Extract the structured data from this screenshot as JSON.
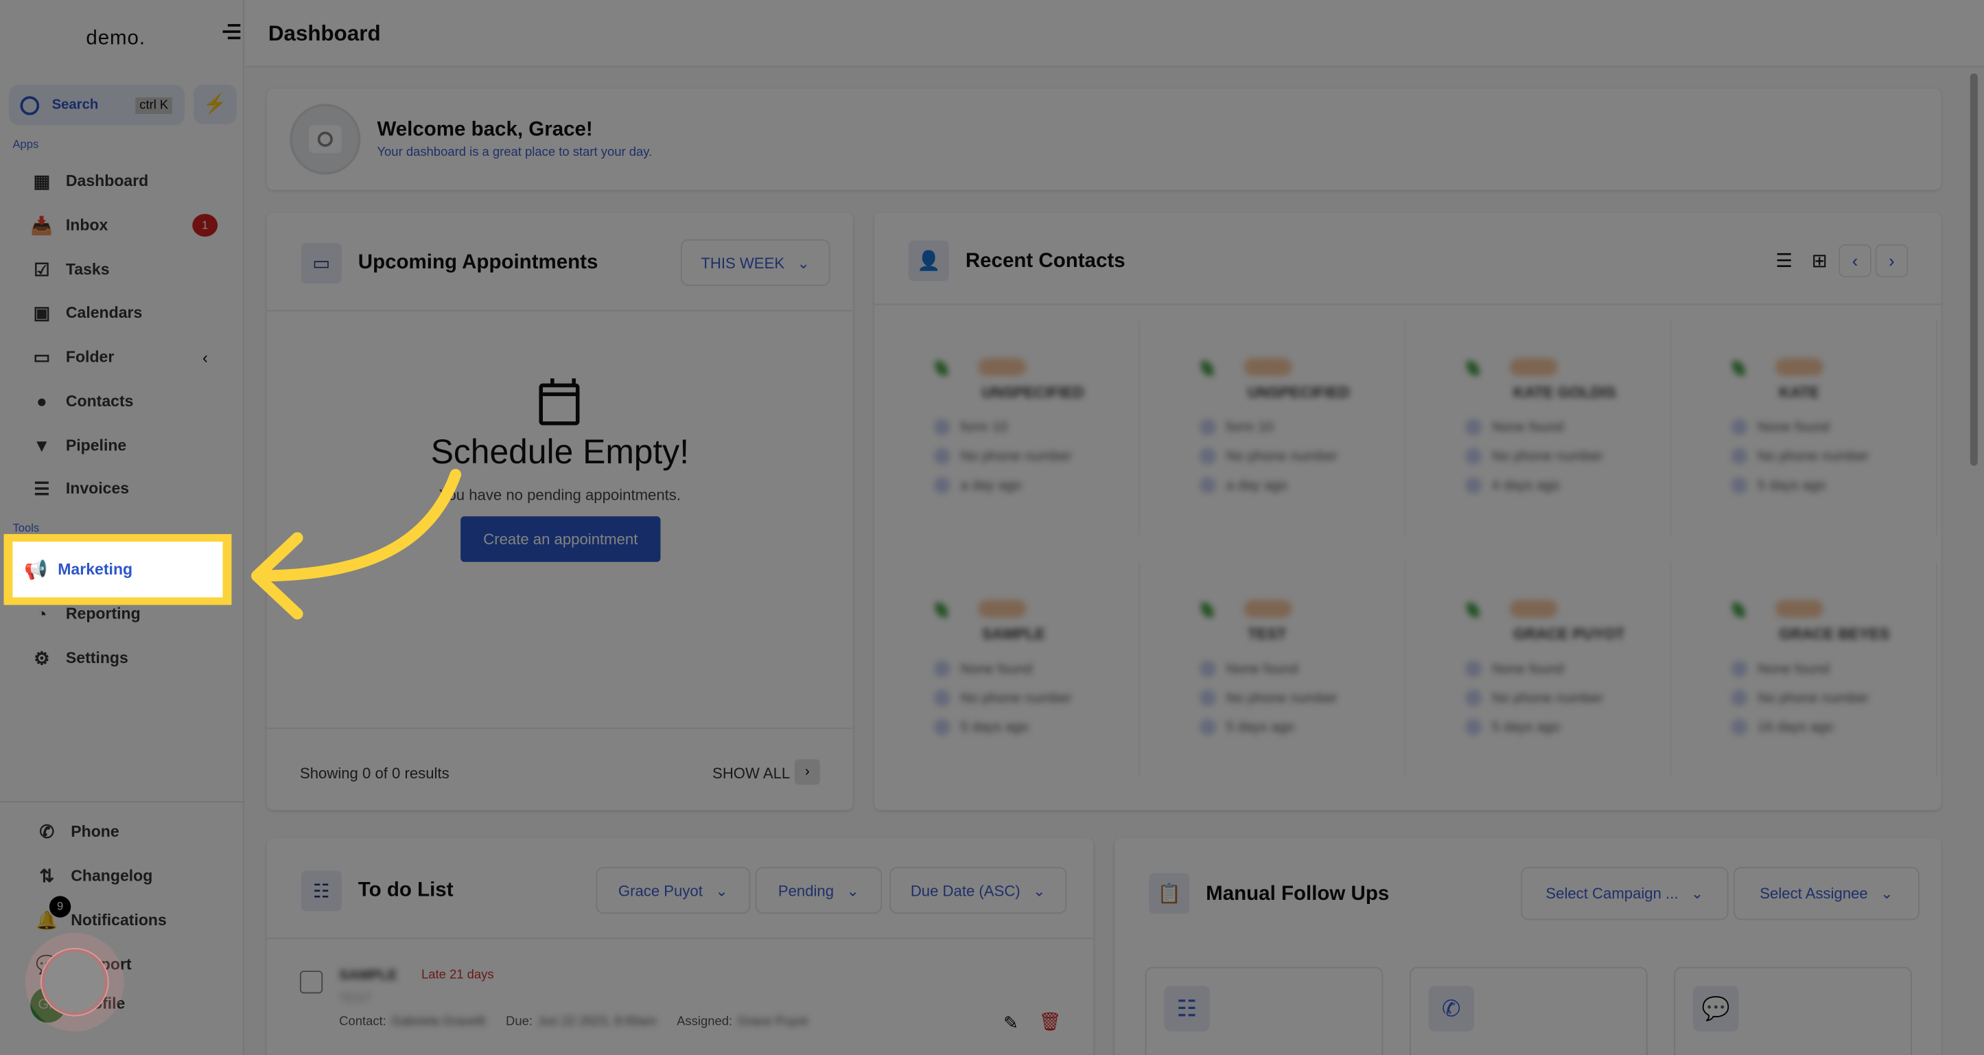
{
  "sidebar": {
    "logo": "demo.",
    "search_label": "Search",
    "search_shortcut": "ctrl K",
    "apps_heading": "Apps",
    "tools_heading": "Tools",
    "apps": [
      {
        "label": "Dashboard",
        "icon": "grid-icon"
      },
      {
        "label": "Inbox",
        "icon": "inbox-icon",
        "badge": "1"
      },
      {
        "label": "Tasks",
        "icon": "clipboard-icon"
      },
      {
        "label": "Calendars",
        "icon": "calendar-icon"
      },
      {
        "label": "Folder",
        "icon": "folder-icon"
      },
      {
        "label": "Contacts",
        "icon": "person-icon"
      },
      {
        "label": "Pipeline",
        "icon": "filter-icon"
      },
      {
        "label": "Invoices",
        "icon": "invoice-icon"
      }
    ],
    "tools": [
      {
        "label": "Marketing",
        "icon": "megaphone-icon"
      },
      {
        "label": "Reporting",
        "icon": "chart-icon"
      },
      {
        "label": "Settings",
        "icon": "gear-icon"
      }
    ],
    "bottom": [
      {
        "label": "Phone"
      },
      {
        "label": "Changelog"
      },
      {
        "label": "Notifications",
        "badge": "9"
      },
      {
        "label": "Support"
      },
      {
        "label": "Profile",
        "avatar": "GP"
      }
    ]
  },
  "header": {
    "title": "Dashboard"
  },
  "welcome": {
    "title": "Welcome back, Grace!",
    "subtitle": "Your dashboard is a great place to start your day."
  },
  "appointments": {
    "title": "Upcoming Appointments",
    "filter": "THIS WEEK",
    "empty_title": "Schedule Empty!",
    "empty_sub": "You have no pending appointments.",
    "create_label": "Create an appointment",
    "results": "Showing 0 of 0 results",
    "show_all": "SHOW ALL"
  },
  "contacts": {
    "title": "Recent Contacts",
    "cards": [
      {
        "name": "UNSPECIFIED",
        "email": "form 10",
        "phone": "No phone number",
        "time": "a day ago"
      },
      {
        "name": "UNSPECIFIED",
        "email": "form 10",
        "phone": "No phone number",
        "time": "a day ago"
      },
      {
        "name": "KATE GOLDIS",
        "email": "None found",
        "phone": "No phone number",
        "time": "4 days ago"
      },
      {
        "name": "KATE",
        "email": "None found",
        "phone": "No phone number",
        "time": "5 days ago"
      },
      {
        "name": "SAMPLE",
        "email": "None found",
        "phone": "No phone number",
        "time": "5 days ago"
      },
      {
        "name": "TEST",
        "email": "None found",
        "phone": "No phone number",
        "time": "5 days ago"
      },
      {
        "name": "GRACE PUYOT",
        "email": "None found",
        "phone": "No phone number",
        "time": "5 days ago"
      },
      {
        "name": "GRACE BEYES",
        "email": "None found",
        "phone": "No phone number",
        "time": "16 days ago"
      }
    ]
  },
  "todo": {
    "title": "To do List",
    "filters": [
      "Grace Puyot",
      "Pending",
      "Due Date (ASC)"
    ],
    "item": {
      "title": "SAMPLE",
      "late": "Late 21 days",
      "desc": "TEST",
      "contact_label": "Contact:",
      "contact": "Gabriela Gravelli",
      "due_label": "Due:",
      "due": "Jun 22 2023, 8:00am",
      "assigned_label": "Assigned:",
      "assigned": "Grace Puyot"
    }
  },
  "followups": {
    "title": "Manual Follow Ups",
    "campaign": "Select Campaign ...",
    "assignee": "Select Assignee"
  },
  "colors": {
    "accent": "#2c56c9",
    "highlight": "#fdd33b",
    "danger": "#d42222"
  }
}
